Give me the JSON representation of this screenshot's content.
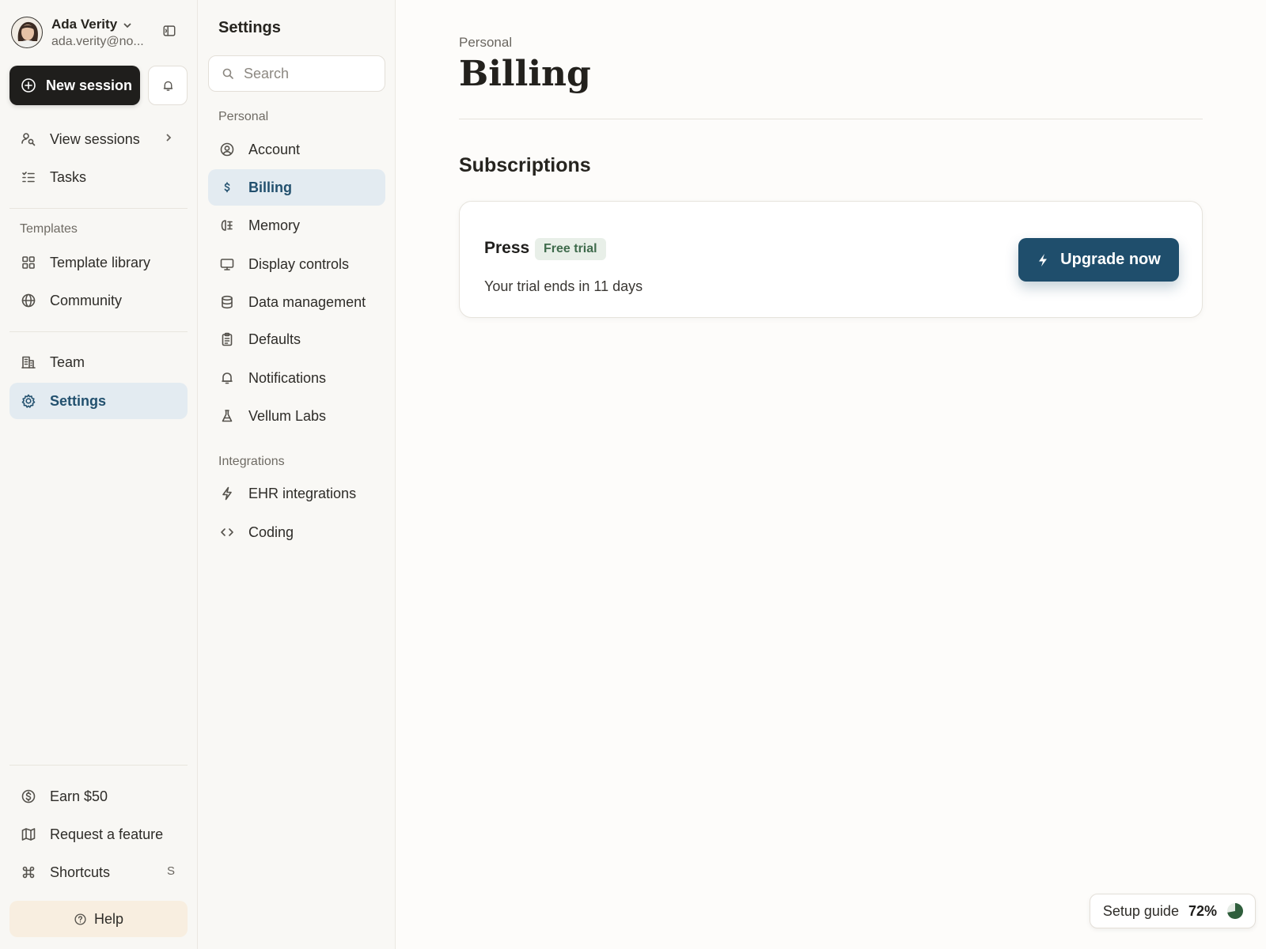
{
  "user": {
    "name": "Ada Verity",
    "email": "ada.verity@no..."
  },
  "sidebar": {
    "new_session_label": "New session",
    "primary_items": [
      {
        "label": "View sessions",
        "icon": "user-search-icon"
      },
      {
        "label": "Tasks",
        "icon": "task-list-icon"
      }
    ],
    "templates_heading": "Templates",
    "template_items": [
      {
        "label": "Template library",
        "icon": "grid-icon"
      },
      {
        "label": "Community",
        "icon": "globe-icon"
      }
    ],
    "team_items": [
      {
        "label": "Team",
        "icon": "building-icon"
      },
      {
        "label": "Settings",
        "icon": "gear-icon",
        "active": true
      }
    ],
    "bottom_items": [
      {
        "label": "Earn $50",
        "icon": "dollar-circle-icon"
      },
      {
        "label": "Request a feature",
        "icon": "map-icon"
      },
      {
        "label": "Shortcuts",
        "icon": "command-icon",
        "shortcut": "S"
      }
    ],
    "help_label": "Help"
  },
  "settings_nav": {
    "title": "Settings",
    "search_placeholder": "Search",
    "personal_heading": "Personal",
    "personal_items": [
      {
        "label": "Account",
        "icon": "user-circle-icon"
      },
      {
        "label": "Billing",
        "icon": "dollar-icon",
        "active": true
      },
      {
        "label": "Memory",
        "icon": "memory-icon"
      },
      {
        "label": "Display controls",
        "icon": "monitor-icon"
      },
      {
        "label": "Data management",
        "icon": "database-icon"
      },
      {
        "label": "Defaults",
        "icon": "clipboard-icon"
      },
      {
        "label": "Notifications",
        "icon": "bell-icon"
      },
      {
        "label": "Vellum Labs",
        "icon": "flask-icon"
      }
    ],
    "integrations_heading": "Integrations",
    "integration_items": [
      {
        "label": "EHR integrations",
        "icon": "bolt-icon"
      },
      {
        "label": "Coding",
        "icon": "code-icon"
      }
    ]
  },
  "main": {
    "breadcrumb": "Personal",
    "title": "Billing",
    "subscriptions_heading": "Subscriptions",
    "subscription": {
      "plan_name": "Press",
      "badge": "Free trial",
      "trial_text": "Your trial ends in 11 days",
      "upgrade_label": "Upgrade now"
    }
  },
  "setup_guide": {
    "label": "Setup guide",
    "percent_text": "72%",
    "progress": 0.72
  },
  "colors": {
    "accent": "#1f4e6c",
    "active_bg": "#e3ebf1",
    "badge_bg": "#e8efe8",
    "badge_text": "#3f6b4c",
    "progress_fill": "#2f5e3c"
  }
}
